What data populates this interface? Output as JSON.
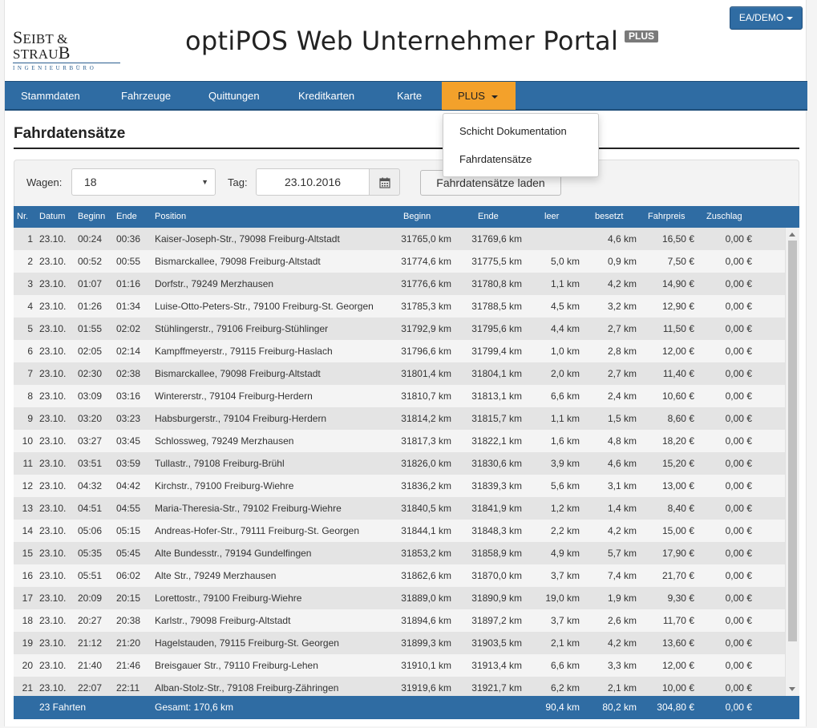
{
  "header": {
    "logo_main_1": "S",
    "logo_main_2": "EIBT & STRAU",
    "logo_main_3": "B",
    "logo_sub": "INGENIEURBÜRO",
    "title": "optiPOS Web Unternehmer Portal",
    "badge": "PLUS",
    "user_button": "EA/DEMO"
  },
  "nav": {
    "items": [
      "Stammdaten",
      "Fahrzeuge",
      "Quittungen",
      "Kreditkarten",
      "Karte",
      "PLUS"
    ],
    "active": "PLUS"
  },
  "dropdown": {
    "items": [
      "Schicht Dokumentation",
      "Fahrdatensätze"
    ]
  },
  "page": {
    "title": "Fahrdatensätze"
  },
  "filter": {
    "wagen_label": "Wagen:",
    "wagen_value": "18",
    "tag_label": "Tag:",
    "date_value": "23.10.2016",
    "load_button": "Fahrdatensätze laden"
  },
  "table": {
    "columns": [
      "Nr.",
      "Datum",
      "Beginn",
      "Ende",
      "Position",
      "Beginn",
      "Ende",
      "leer",
      "besetzt",
      "Fahrpreis",
      "Zuschlag"
    ],
    "rows": [
      [
        "1",
        "23.10.",
        "00:24",
        "00:36",
        "Kaiser-Joseph-Str., 79098 Freiburg-Altstadt",
        "31765,0 km",
        "31769,6 km",
        "",
        "4,6 km",
        "16,50 €",
        "0,00 €"
      ],
      [
        "2",
        "23.10.",
        "00:52",
        "00:55",
        "Bismarckallee, 79098 Freiburg-Altstadt",
        "31774,6 km",
        "31775,5 km",
        "5,0 km",
        "0,9 km",
        "7,50 €",
        "0,00 €"
      ],
      [
        "3",
        "23.10.",
        "01:07",
        "01:16",
        "Dorfstr., 79249 Merzhausen",
        "31776,6 km",
        "31780,8 km",
        "1,1 km",
        "4,2 km",
        "14,90 €",
        "0,00 €"
      ],
      [
        "4",
        "23.10.",
        "01:26",
        "01:34",
        "Luise-Otto-Peters-Str., 79100 Freiburg-St. Georgen",
        "31785,3 km",
        "31788,5 km",
        "4,5 km",
        "3,2 km",
        "12,90 €",
        "0,00 €"
      ],
      [
        "5",
        "23.10.",
        "01:55",
        "02:02",
        "Stühlingerstr., 79106 Freiburg-Stühlinger",
        "31792,9 km",
        "31795,6 km",
        "4,4 km",
        "2,7 km",
        "11,50 €",
        "0,00 €"
      ],
      [
        "6",
        "23.10.",
        "02:05",
        "02:14",
        "Kampffmeyerstr., 79115 Freiburg-Haslach",
        "31796,6 km",
        "31799,4 km",
        "1,0 km",
        "2,8 km",
        "12,00 €",
        "0,00 €"
      ],
      [
        "7",
        "23.10.",
        "02:30",
        "02:38",
        "Bismarckallee, 79098 Freiburg-Altstadt",
        "31801,4 km",
        "31804,1 km",
        "2,0 km",
        "2,7 km",
        "11,40 €",
        "0,00 €"
      ],
      [
        "8",
        "23.10.",
        "03:09",
        "03:16",
        "Wintererstr., 79104 Freiburg-Herdern",
        "31810,7 km",
        "31813,1 km",
        "6,6 km",
        "2,4 km",
        "10,60 €",
        "0,00 €"
      ],
      [
        "9",
        "23.10.",
        "03:20",
        "03:23",
        "Habsburgerstr., 79104 Freiburg-Herdern",
        "31814,2 km",
        "31815,7 km",
        "1,1 km",
        "1,5 km",
        "8,60 €",
        "0,00 €"
      ],
      [
        "10",
        "23.10.",
        "03:27",
        "03:45",
        "Schlossweg, 79249 Merzhausen",
        "31817,3 km",
        "31822,1 km",
        "1,6 km",
        "4,8 km",
        "18,20 €",
        "0,00 €"
      ],
      [
        "11",
        "23.10.",
        "03:51",
        "03:59",
        "Tullastr., 79108 Freiburg-Brühl",
        "31826,0 km",
        "31830,6 km",
        "3,9 km",
        "4,6 km",
        "15,20 €",
        "0,00 €"
      ],
      [
        "12",
        "23.10.",
        "04:32",
        "04:42",
        "Kirchstr., 79100 Freiburg-Wiehre",
        "31836,2 km",
        "31839,3 km",
        "5,6 km",
        "3,1 km",
        "13,00 €",
        "0,00 €"
      ],
      [
        "13",
        "23.10.",
        "04:51",
        "04:55",
        "Maria-Theresia-Str., 79102 Freiburg-Wiehre",
        "31840,5 km",
        "31841,9 km",
        "1,2 km",
        "1,4 km",
        "8,40 €",
        "0,00 €"
      ],
      [
        "14",
        "23.10.",
        "05:06",
        "05:15",
        "Andreas-Hofer-Str., 79111 Freiburg-St. Georgen",
        "31844,1 km",
        "31848,3 km",
        "2,2 km",
        "4,2 km",
        "15,00 €",
        "0,00 €"
      ],
      [
        "15",
        "23.10.",
        "05:35",
        "05:45",
        "Alte Bundesstr., 79194 Gundelfingen",
        "31853,2 km",
        "31858,9 km",
        "4,9 km",
        "5,7 km",
        "17,90 €",
        "0,00 €"
      ],
      [
        "16",
        "23.10.",
        "05:51",
        "06:02",
        "Alte Str., 79249 Merzhausen",
        "31862,6 km",
        "31870,0 km",
        "3,7 km",
        "7,4 km",
        "21,70 €",
        "0,00 €"
      ],
      [
        "17",
        "23.10.",
        "20:09",
        "20:15",
        "Lorettostr., 79100 Freiburg-Wiehre",
        "31889,0 km",
        "31890,9 km",
        "19,0 km",
        "1,9 km",
        "9,30 €",
        "0,00 €"
      ],
      [
        "18",
        "23.10.",
        "20:27",
        "20:38",
        "Karlstr., 79098 Freiburg-Altstadt",
        "31894,6 km",
        "31897,2 km",
        "3,7 km",
        "2,6 km",
        "11,70 €",
        "0,00 €"
      ],
      [
        "19",
        "23.10.",
        "21:12",
        "21:20",
        "Hagelstauden, 79115 Freiburg-St. Georgen",
        "31899,3 km",
        "31903,5 km",
        "2,1 km",
        "4,2 km",
        "13,60 €",
        "0,00 €"
      ],
      [
        "20",
        "23.10.",
        "21:40",
        "21:46",
        "Breisgauer Str., 79110 Freiburg-Lehen",
        "31910,1 km",
        "31913,4 km",
        "6,6 km",
        "3,3 km",
        "12,00 €",
        "0,00 €"
      ],
      [
        "21",
        "23.10.",
        "22:07",
        "22:11",
        "Alban-Stolz-Str., 79108 Freiburg-Zähringen",
        "31919,6 km",
        "31921,7 km",
        "6,2 km",
        "2,1 km",
        "10,00 €",
        "0,00 €"
      ]
    ],
    "footer": {
      "count": "23 Fahrten",
      "total": "Gesamt: 170,6 km",
      "leer": "90,4 km",
      "besetzt": "80,2 km",
      "fahrpreis": "304,80 €",
      "zuschlag": "0,00 €"
    }
  },
  "colors": {
    "primary": "#2f6ca3",
    "accent": "#f3a12b",
    "badge": "#7a7a7a"
  }
}
